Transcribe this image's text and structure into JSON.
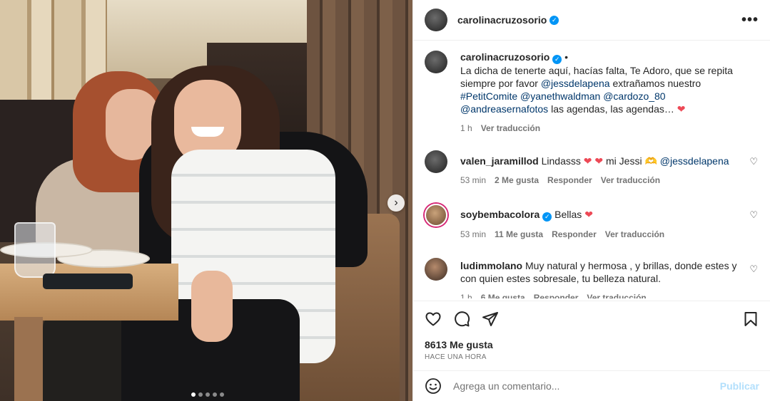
{
  "header": {
    "username": "carolinacruzosorio",
    "verified": true,
    "more_label": "•••"
  },
  "carousel": {
    "slides": 5,
    "active": 0,
    "next_label": "›"
  },
  "caption": {
    "username": "carolinacruzosorio",
    "separator": "•",
    "text_1": "La dicha de tenerte aquí, hacías falta, Te Adoro, que se repita siempre por favor ",
    "mention_1": "@jessdelapena",
    "text_2": " extrañamos nuestro ",
    "tag_1": "#PetitComite",
    "space_1": " ",
    "mention_2": "@yanethwaldman",
    "space_2": " ",
    "mention_3": "@cardozo_80",
    "space_3": " ",
    "mention_4": "@andreasernafotos",
    "text_3": " las agendas, las agendas… ",
    "time": "1 h",
    "translate": "Ver traducción"
  },
  "comments": [
    {
      "username": "valen_jaramillod",
      "text_before": "Lindasss ",
      "text_after": " mi Jessi 🫶 ",
      "mention": "@jessdelapena",
      "time": "53 min",
      "likes": "2 Me gusta",
      "reply": "Responder",
      "translate": "Ver traducción"
    },
    {
      "username": "soybembacolora",
      "verified": true,
      "text": "Bellas",
      "time": "53 min",
      "likes": "11 Me gusta",
      "reply": "Responder",
      "translate": "Ver traducción"
    },
    {
      "username": "ludimmolano",
      "text": "Muy natural y hermosa , y brillas, donde estes y con quien estes sobresale, tu belleza natural.",
      "time": "1 h",
      "likes": "6 Me gusta",
      "reply": "Responder",
      "translate": "Ver traducción"
    }
  ],
  "heart_glyph": "❤",
  "verified_glyph": "✓",
  "like_glyph": "♡",
  "likes_count": "8613 Me gusta",
  "posted_ago": "HACE UNA HORA",
  "add_comment": {
    "placeholder": "Agrega un comentario...",
    "post_label": "Publicar"
  },
  "colors": {
    "link": "#00376b",
    "verified": "#0095f6",
    "heart": "#ed4956",
    "muted": "#737373",
    "publish_disabled": "#b2dffc"
  }
}
